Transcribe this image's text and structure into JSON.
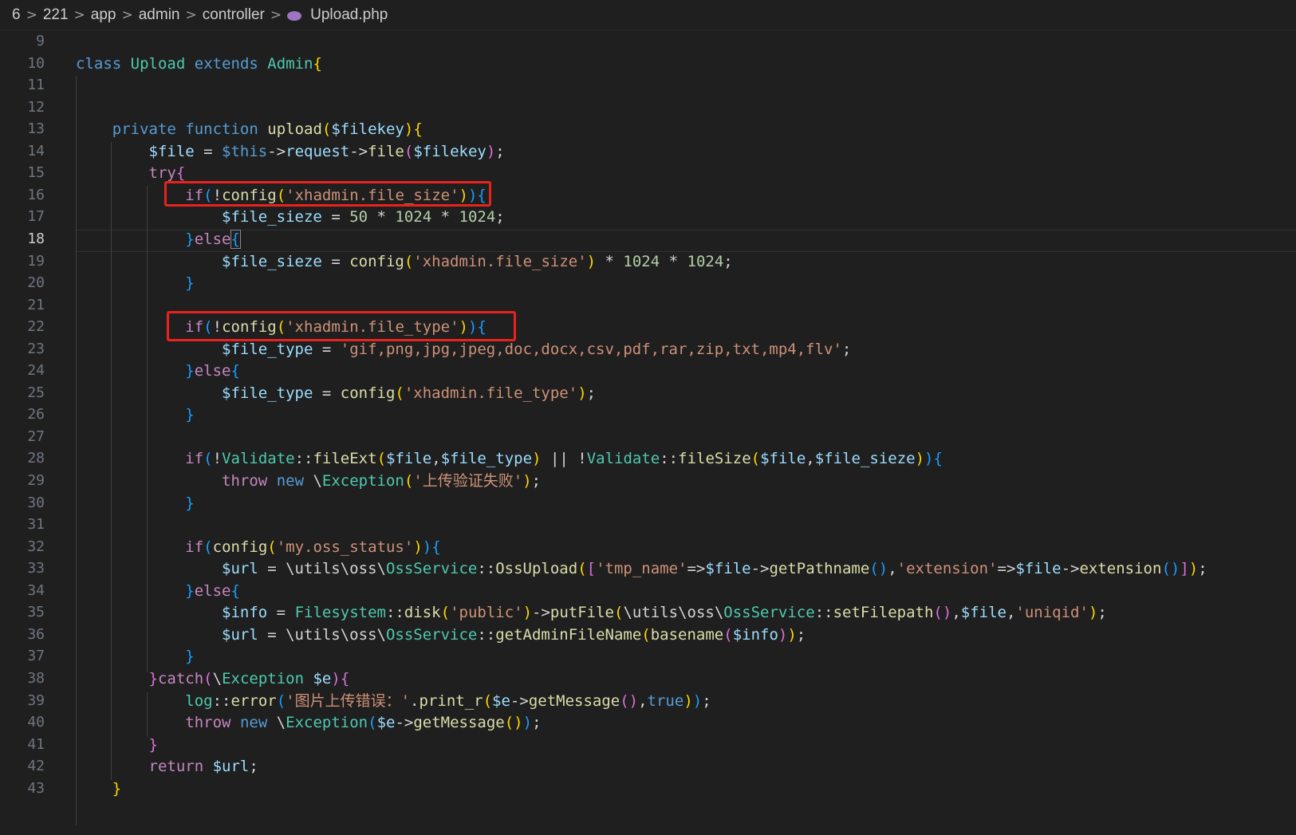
{
  "breadcrumb": {
    "items": [
      "6",
      "221",
      "app",
      "admin",
      "controller"
    ],
    "file": "Upload.php",
    "file_icon": "php-elephant-icon",
    "separator": ">"
  },
  "editor": {
    "active_line": "18",
    "lines": [
      {
        "n": "9",
        "tokens": []
      },
      {
        "n": "10",
        "tokens": [
          [
            "kw",
            "class"
          ],
          [
            "op",
            " "
          ],
          [
            "cls",
            "Upload"
          ],
          [
            "op",
            " "
          ],
          [
            "kw",
            "extends"
          ],
          [
            "op",
            " "
          ],
          [
            "cls",
            "Admin"
          ],
          [
            "p1",
            "{"
          ]
        ]
      },
      {
        "n": "11",
        "tokens": []
      },
      {
        "n": "12",
        "tokens": []
      },
      {
        "n": "13",
        "tokens": [
          [
            "op",
            "    "
          ],
          [
            "kw",
            "private"
          ],
          [
            "op",
            " "
          ],
          [
            "kw",
            "function"
          ],
          [
            "op",
            " "
          ],
          [
            "fn",
            "upload"
          ],
          [
            "p1",
            "("
          ],
          [
            "var",
            "$filekey"
          ],
          [
            "p1",
            ")"
          ],
          [
            "p1",
            "{"
          ]
        ]
      },
      {
        "n": "14",
        "tokens": [
          [
            "op",
            "        "
          ],
          [
            "var",
            "$file"
          ],
          [
            "op",
            " = "
          ],
          [
            "kw",
            "$this"
          ],
          [
            "op",
            "->"
          ],
          [
            "var",
            "request"
          ],
          [
            "op",
            "->"
          ],
          [
            "fn",
            "file"
          ],
          [
            "p2",
            "("
          ],
          [
            "var",
            "$filekey"
          ],
          [
            "p2",
            ")"
          ],
          [
            "op",
            ";"
          ]
        ]
      },
      {
        "n": "15",
        "tokens": [
          [
            "op",
            "        "
          ],
          [
            "ctl",
            "try"
          ],
          [
            "p2",
            "{"
          ]
        ]
      },
      {
        "n": "16",
        "tokens": [
          [
            "op",
            "            "
          ],
          [
            "ctl",
            "if"
          ],
          [
            "p3",
            "("
          ],
          [
            "op",
            "!"
          ],
          [
            "fn",
            "config"
          ],
          [
            "p1",
            "("
          ],
          [
            "str",
            "'xhadmin.file_size'"
          ],
          [
            "p1",
            ")"
          ],
          [
            "p3",
            ")"
          ],
          [
            "p3",
            "{"
          ]
        ]
      },
      {
        "n": "17",
        "tokens": [
          [
            "op",
            "                "
          ],
          [
            "var",
            "$file_sieze"
          ],
          [
            "op",
            " = "
          ],
          [
            "num",
            "50"
          ],
          [
            "op",
            " * "
          ],
          [
            "num",
            "1024"
          ],
          [
            "op",
            " * "
          ],
          [
            "num",
            "1024"
          ],
          [
            "op",
            ";"
          ]
        ]
      },
      {
        "n": "18",
        "tokens": [
          [
            "op",
            "            "
          ],
          [
            "p3",
            "}"
          ],
          [
            "ctl",
            "else"
          ],
          [
            "p3",
            "{"
          ]
        ]
      },
      {
        "n": "19",
        "tokens": [
          [
            "op",
            "                "
          ],
          [
            "var",
            "$file_sieze"
          ],
          [
            "op",
            " = "
          ],
          [
            "fn",
            "config"
          ],
          [
            "p1",
            "("
          ],
          [
            "str",
            "'xhadmin.file_size'"
          ],
          [
            "p1",
            ")"
          ],
          [
            "op",
            " * "
          ],
          [
            "num",
            "1024"
          ],
          [
            "op",
            " * "
          ],
          [
            "num",
            "1024"
          ],
          [
            "op",
            ";"
          ]
        ]
      },
      {
        "n": "20",
        "tokens": [
          [
            "op",
            "            "
          ],
          [
            "p3",
            "}"
          ]
        ]
      },
      {
        "n": "21",
        "tokens": []
      },
      {
        "n": "22",
        "tokens": [
          [
            "op",
            "            "
          ],
          [
            "ctl",
            "if"
          ],
          [
            "p3",
            "("
          ],
          [
            "op",
            "!"
          ],
          [
            "fn",
            "config"
          ],
          [
            "p1",
            "("
          ],
          [
            "str",
            "'xhadmin.file_type'"
          ],
          [
            "p1",
            ")"
          ],
          [
            "p3",
            ")"
          ],
          [
            "p3",
            "{"
          ]
        ]
      },
      {
        "n": "23",
        "tokens": [
          [
            "op",
            "                "
          ],
          [
            "var",
            "$file_type"
          ],
          [
            "op",
            " = "
          ],
          [
            "str",
            "'gif,png,jpg,jpeg,doc,docx,csv,pdf,rar,zip,txt,mp4,flv'"
          ],
          [
            "op",
            ";"
          ]
        ]
      },
      {
        "n": "24",
        "tokens": [
          [
            "op",
            "            "
          ],
          [
            "p3",
            "}"
          ],
          [
            "ctl",
            "else"
          ],
          [
            "p3",
            "{"
          ]
        ]
      },
      {
        "n": "25",
        "tokens": [
          [
            "op",
            "                "
          ],
          [
            "var",
            "$file_type"
          ],
          [
            "op",
            " = "
          ],
          [
            "fn",
            "config"
          ],
          [
            "p1",
            "("
          ],
          [
            "str",
            "'xhadmin.file_type'"
          ],
          [
            "p1",
            ")"
          ],
          [
            "op",
            ";"
          ]
        ]
      },
      {
        "n": "26",
        "tokens": [
          [
            "op",
            "            "
          ],
          [
            "p3",
            "}"
          ]
        ]
      },
      {
        "n": "27",
        "tokens": []
      },
      {
        "n": "28",
        "tokens": [
          [
            "op",
            "            "
          ],
          [
            "ctl",
            "if"
          ],
          [
            "p3",
            "("
          ],
          [
            "op",
            "!"
          ],
          [
            "cls",
            "Validate"
          ],
          [
            "op",
            "::"
          ],
          [
            "fn",
            "fileExt"
          ],
          [
            "p1",
            "("
          ],
          [
            "var",
            "$file"
          ],
          [
            "op",
            ","
          ],
          [
            "var",
            "$file_type"
          ],
          [
            "p1",
            ")"
          ],
          [
            "op",
            " || !"
          ],
          [
            "cls",
            "Validate"
          ],
          [
            "op",
            "::"
          ],
          [
            "fn",
            "fileSize"
          ],
          [
            "p1",
            "("
          ],
          [
            "var",
            "$file"
          ],
          [
            "op",
            ","
          ],
          [
            "var",
            "$file_sieze"
          ],
          [
            "p1",
            ")"
          ],
          [
            "p3",
            ")"
          ],
          [
            "p3",
            "{"
          ]
        ]
      },
      {
        "n": "29",
        "tokens": [
          [
            "op",
            "                "
          ],
          [
            "ctl",
            "throw"
          ],
          [
            "op",
            " "
          ],
          [
            "kw",
            "new"
          ],
          [
            "op",
            " \\"
          ],
          [
            "cls",
            "Exception"
          ],
          [
            "p1",
            "("
          ],
          [
            "str",
            "'上传验证失败'"
          ],
          [
            "p1",
            ")"
          ],
          [
            "op",
            ";"
          ]
        ]
      },
      {
        "n": "30",
        "tokens": [
          [
            "op",
            "            "
          ],
          [
            "p3",
            "}"
          ]
        ]
      },
      {
        "n": "31",
        "tokens": []
      },
      {
        "n": "32",
        "tokens": [
          [
            "op",
            "            "
          ],
          [
            "ctl",
            "if"
          ],
          [
            "p3",
            "("
          ],
          [
            "fn",
            "config"
          ],
          [
            "p1",
            "("
          ],
          [
            "str",
            "'my.oss_status'"
          ],
          [
            "p1",
            ")"
          ],
          [
            "p3",
            ")"
          ],
          [
            "p3",
            "{"
          ]
        ]
      },
      {
        "n": "33",
        "tokens": [
          [
            "op",
            "                "
          ],
          [
            "var",
            "$url"
          ],
          [
            "op",
            " = \\utils\\oss\\"
          ],
          [
            "cls",
            "OssService"
          ],
          [
            "op",
            "::"
          ],
          [
            "fn",
            "OssUpload"
          ],
          [
            "p1",
            "("
          ],
          [
            "p2",
            "["
          ],
          [
            "str",
            "'tmp_name'"
          ],
          [
            "op",
            "=>"
          ],
          [
            "var",
            "$file"
          ],
          [
            "op",
            "->"
          ],
          [
            "fn",
            "getPathname"
          ],
          [
            "p3",
            "()"
          ],
          [
            "op",
            ","
          ],
          [
            "str",
            "'extension'"
          ],
          [
            "op",
            "=>"
          ],
          [
            "var",
            "$file"
          ],
          [
            "op",
            "->"
          ],
          [
            "fn",
            "extension"
          ],
          [
            "p3",
            "()"
          ],
          [
            "p2",
            "]"
          ],
          [
            "p1",
            ")"
          ],
          [
            "op",
            ";"
          ]
        ]
      },
      {
        "n": "34",
        "tokens": [
          [
            "op",
            "            "
          ],
          [
            "p3",
            "}"
          ],
          [
            "ctl",
            "else"
          ],
          [
            "p3",
            "{"
          ]
        ]
      },
      {
        "n": "35",
        "tokens": [
          [
            "op",
            "                "
          ],
          [
            "var",
            "$info"
          ],
          [
            "op",
            " = "
          ],
          [
            "cls",
            "Filesystem"
          ],
          [
            "op",
            "::"
          ],
          [
            "fn",
            "disk"
          ],
          [
            "p1",
            "("
          ],
          [
            "str",
            "'public'"
          ],
          [
            "p1",
            ")"
          ],
          [
            "op",
            "->"
          ],
          [
            "fn",
            "putFile"
          ],
          [
            "p1",
            "("
          ],
          [
            "op",
            "\\utils\\oss\\"
          ],
          [
            "cls",
            "OssService"
          ],
          [
            "op",
            "::"
          ],
          [
            "fn",
            "setFilepath"
          ],
          [
            "p2",
            "()"
          ],
          [
            "op",
            ","
          ],
          [
            "var",
            "$file"
          ],
          [
            "op",
            ","
          ],
          [
            "str",
            "'uniqid'"
          ],
          [
            "p1",
            ")"
          ],
          [
            "op",
            ";"
          ]
        ]
      },
      {
        "n": "36",
        "tokens": [
          [
            "op",
            "                "
          ],
          [
            "var",
            "$url"
          ],
          [
            "op",
            " = \\utils\\oss\\"
          ],
          [
            "cls",
            "OssService"
          ],
          [
            "op",
            "::"
          ],
          [
            "fn",
            "getAdminFileName"
          ],
          [
            "p1",
            "("
          ],
          [
            "fn",
            "basename"
          ],
          [
            "p2",
            "("
          ],
          [
            "var",
            "$info"
          ],
          [
            "p2",
            ")"
          ],
          [
            "p1",
            ")"
          ],
          [
            "op",
            ";"
          ]
        ]
      },
      {
        "n": "37",
        "tokens": [
          [
            "op",
            "            "
          ],
          [
            "p3",
            "}"
          ]
        ]
      },
      {
        "n": "38",
        "tokens": [
          [
            "op",
            "        "
          ],
          [
            "p2",
            "}"
          ],
          [
            "ctl",
            "catch"
          ],
          [
            "p2",
            "("
          ],
          [
            "op",
            "\\"
          ],
          [
            "cls",
            "Exception"
          ],
          [
            "op",
            " "
          ],
          [
            "var",
            "$e"
          ],
          [
            "p2",
            ")"
          ],
          [
            "p2",
            "{"
          ]
        ]
      },
      {
        "n": "39",
        "tokens": [
          [
            "op",
            "            "
          ],
          [
            "cls",
            "log"
          ],
          [
            "op",
            "::"
          ],
          [
            "fn",
            "error"
          ],
          [
            "p3",
            "("
          ],
          [
            "str",
            "'图片上传错误：'"
          ],
          [
            "op",
            "."
          ],
          [
            "fn",
            "print_r"
          ],
          [
            "p1",
            "("
          ],
          [
            "var",
            "$e"
          ],
          [
            "op",
            "->"
          ],
          [
            "fn",
            "getMessage"
          ],
          [
            "p2",
            "()"
          ],
          [
            "op",
            ","
          ],
          [
            "kw",
            "true"
          ],
          [
            "p1",
            ")"
          ],
          [
            "p3",
            ")"
          ],
          [
            "op",
            ";"
          ]
        ]
      },
      {
        "n": "40",
        "tokens": [
          [
            "op",
            "            "
          ],
          [
            "ctl",
            "throw"
          ],
          [
            "op",
            " "
          ],
          [
            "kw",
            "new"
          ],
          [
            "op",
            " \\"
          ],
          [
            "cls",
            "Exception"
          ],
          [
            "p3",
            "("
          ],
          [
            "var",
            "$e"
          ],
          [
            "op",
            "->"
          ],
          [
            "fn",
            "getMessage"
          ],
          [
            "p1",
            "()"
          ],
          [
            "p3",
            ")"
          ],
          [
            "op",
            ";"
          ]
        ]
      },
      {
        "n": "41",
        "tokens": [
          [
            "op",
            "        "
          ],
          [
            "p2",
            "}"
          ]
        ]
      },
      {
        "n": "42",
        "tokens": [
          [
            "op",
            "        "
          ],
          [
            "ctl",
            "return"
          ],
          [
            "op",
            " "
          ],
          [
            "var",
            "$url"
          ],
          [
            "op",
            ";"
          ]
        ]
      },
      {
        "n": "43",
        "tokens": [
          [
            "op",
            "    "
          ],
          [
            "p1",
            "}"
          ]
        ]
      }
    ]
  },
  "annotations": {
    "box_color": "#e8231e"
  }
}
